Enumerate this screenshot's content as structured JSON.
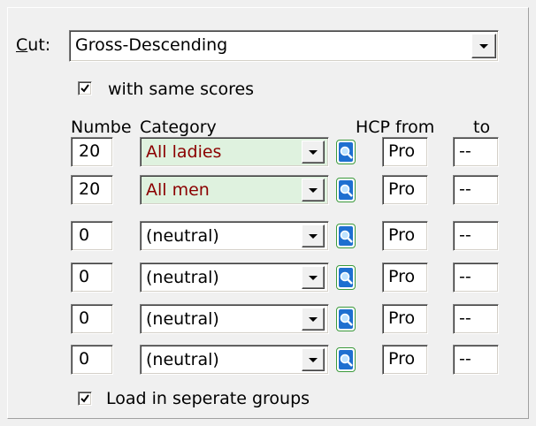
{
  "cut": {
    "label_underlined": "C",
    "label_rest": "ut:",
    "value": "Gross-Descending"
  },
  "same_scores": {
    "checked": true,
    "label": "with same scores"
  },
  "headers": {
    "number": "Numbe",
    "category": "Category",
    "hcp_from": "HCP from",
    "to": "to"
  },
  "rows": [
    {
      "number": "20",
      "category": "All ladies",
      "hcp_from": "Pro",
      "to": "--",
      "highlight": true
    },
    {
      "number": "20",
      "category": "All men",
      "hcp_from": "Pro",
      "to": "--",
      "highlight": true
    },
    {
      "number": "0",
      "category": "(neutral)",
      "hcp_from": "Pro",
      "to": "--",
      "highlight": false
    },
    {
      "number": "0",
      "category": "(neutral)",
      "hcp_from": "Pro",
      "to": "--",
      "highlight": false
    },
    {
      "number": "0",
      "category": "(neutral)",
      "hcp_from": "Pro",
      "to": "--",
      "highlight": false
    },
    {
      "number": "0",
      "category": "(neutral)",
      "hcp_from": "Pro",
      "to": "--",
      "highlight": false
    }
  ],
  "separate_groups": {
    "checked": true,
    "label": "Load in seperate groups"
  },
  "icons": {
    "dropdown": "chevron-down-icon",
    "search": "magnifier-icon",
    "check": "check-icon"
  },
  "colors": {
    "highlight_bg": "#dff2df",
    "highlight_text": "#8b0000",
    "search_button_blue": "#1e6fd0",
    "search_button_border": "#3c9a3c"
  }
}
